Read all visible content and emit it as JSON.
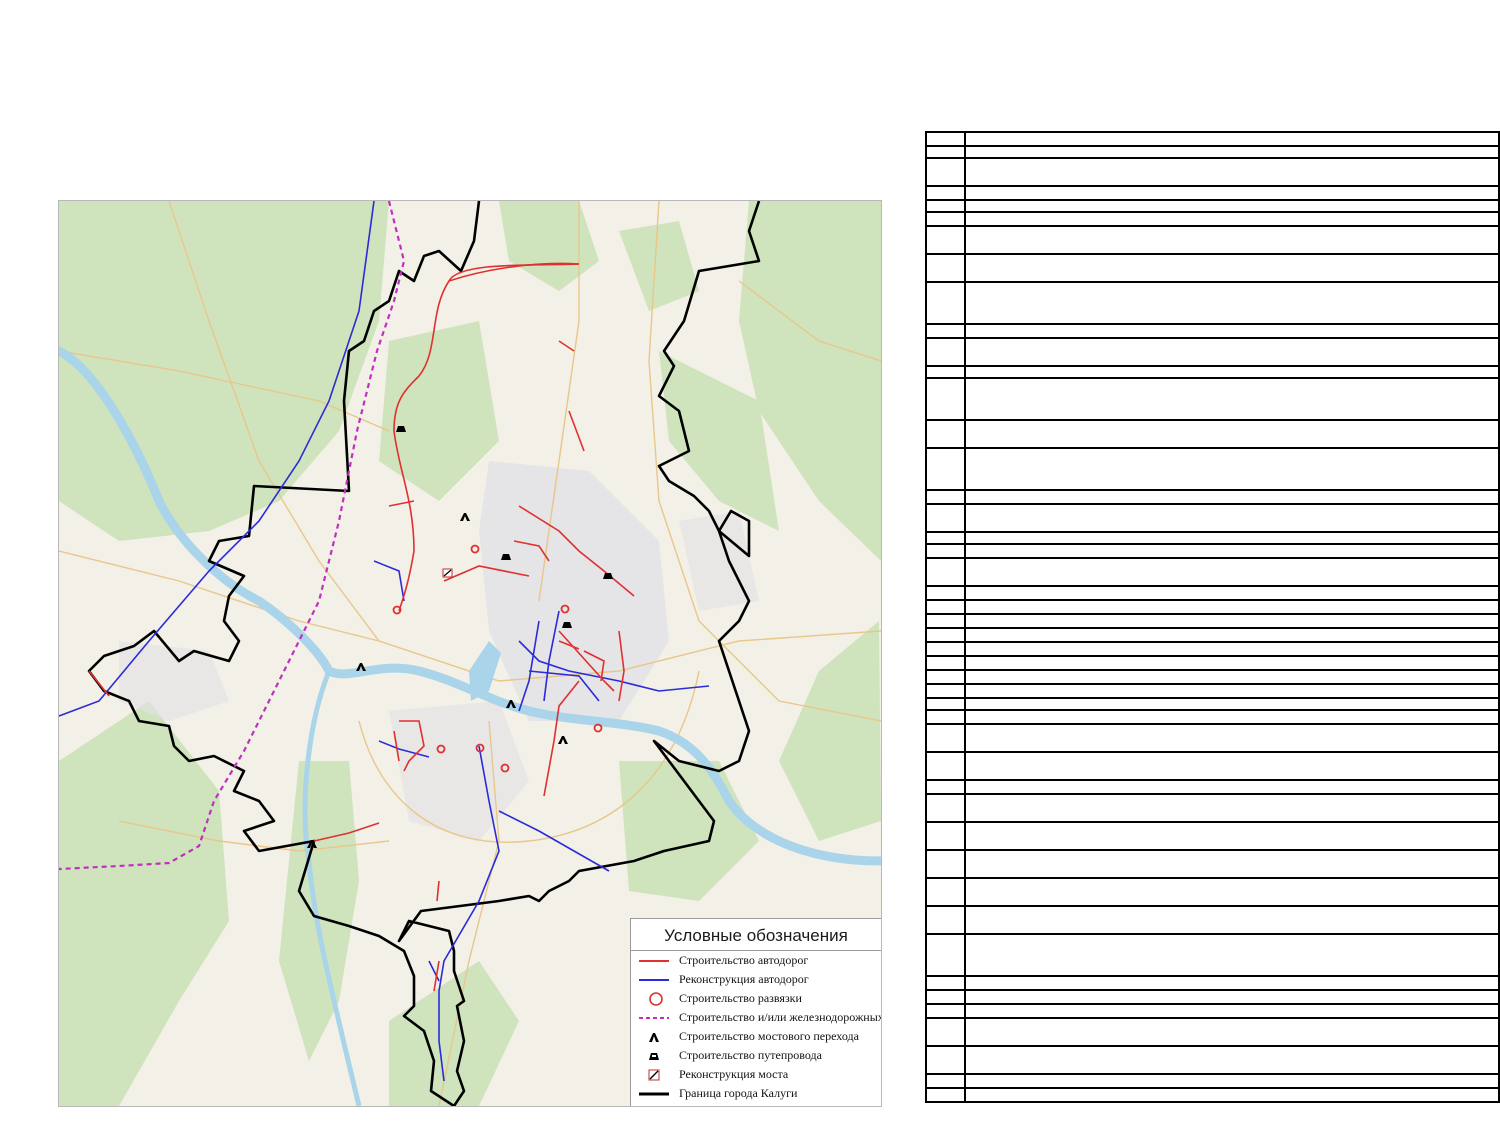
{
  "legend": {
    "title": "Условные обозначения",
    "items": [
      {
        "label": "Строительство автодорог",
        "symbol": "red-line",
        "color": "#e03030"
      },
      {
        "label": "Реконструкция автодорог",
        "symbol": "blue-line",
        "color": "#2b2bd9"
      },
      {
        "label": "Строительство развязки",
        "symbol": "red-circle",
        "color": "#e03030"
      },
      {
        "label": "Строительство и/или железнодорожных путей",
        "symbol": "magenta-dashed-line",
        "color": "#c030c0"
      },
      {
        "label": "Строительство мостового перехода",
        "symbol": "bridge-crossing-icon",
        "color": "#000000"
      },
      {
        "label": "Строительство путепровода",
        "symbol": "overpass-icon",
        "color": "#000000"
      },
      {
        "label": "Реконструкция моста",
        "symbol": "bridge-reconstruction-icon",
        "color": "#c03030"
      },
      {
        "label": "Граница города Калуги",
        "symbol": "black-thick-line",
        "color": "#000000"
      }
    ]
  },
  "colors": {
    "forest": "#cfe3bd",
    "land": "#f2f0e7",
    "urban": "#e1e1e6",
    "water": "#a9d4ea",
    "road_construction": "#e03030",
    "road_reconstruction": "#2b2bd9",
    "railway": "#c030c0",
    "city_boundary": "#000000"
  },
  "table": {
    "rows": [
      [
        "",
        ""
      ],
      [
        "",
        ""
      ],
      [
        "",
        ""
      ],
      [
        "",
        ""
      ],
      [
        "",
        ""
      ],
      [
        "",
        ""
      ],
      [
        "",
        ""
      ],
      [
        "",
        ""
      ],
      [
        "",
        ""
      ],
      [
        "",
        ""
      ],
      [
        "",
        ""
      ],
      [
        "",
        ""
      ],
      [
        "",
        ""
      ],
      [
        "",
        ""
      ],
      [
        "",
        ""
      ],
      [
        "",
        ""
      ],
      [
        "",
        ""
      ],
      [
        "",
        ""
      ],
      [
        "",
        ""
      ],
      [
        "",
        ""
      ],
      [
        "",
        ""
      ],
      [
        "",
        ""
      ],
      [
        "",
        ""
      ],
      [
        "",
        ""
      ],
      [
        "",
        ""
      ],
      [
        "",
        ""
      ],
      [
        "",
        ""
      ],
      [
        "",
        ""
      ],
      [
        "",
        ""
      ],
      [
        "",
        ""
      ],
      [
        "",
        ""
      ],
      [
        "",
        ""
      ],
      [
        "",
        ""
      ],
      [
        "",
        ""
      ],
      [
        "",
        ""
      ],
      [
        "",
        ""
      ],
      [
        "",
        ""
      ],
      [
        "",
        ""
      ],
      [
        "",
        ""
      ],
      [
        "",
        ""
      ],
      [
        "",
        ""
      ],
      [
        "",
        ""
      ],
      [
        "",
        ""
      ],
      [
        "",
        ""
      ],
      [
        "",
        ""
      ],
      [
        "",
        ""
      ]
    ]
  }
}
